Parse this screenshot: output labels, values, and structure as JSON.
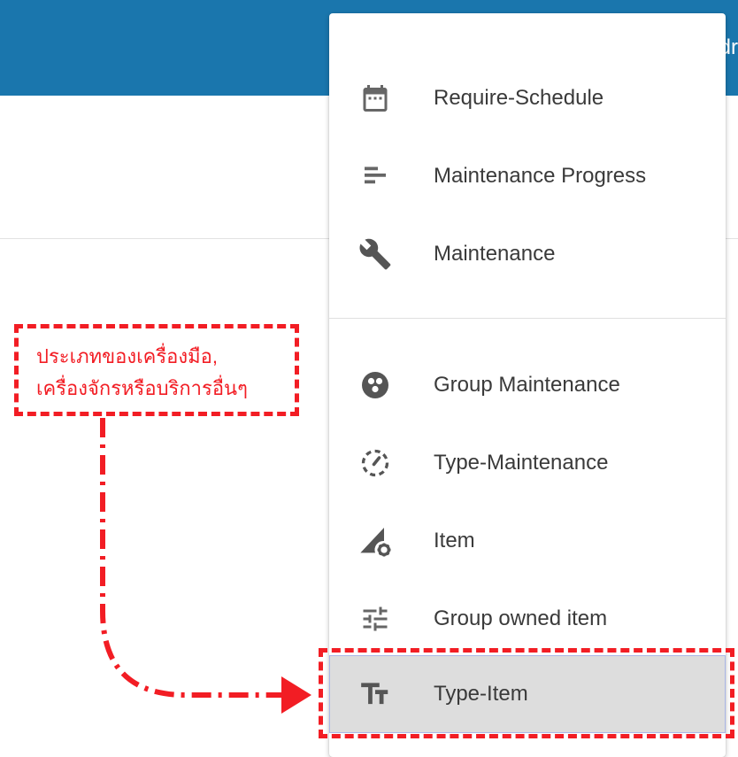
{
  "appbar": {
    "title_fragment": "dr",
    "color": "#1a76ad"
  },
  "menu": {
    "group1": [
      {
        "label": "Require-Schedule",
        "icon": "calendar-icon"
      },
      {
        "label": "Maintenance Progress",
        "icon": "bar-list-icon"
      },
      {
        "label": "Maintenance",
        "icon": "wrench-icon"
      }
    ],
    "group2": [
      {
        "label": "Group Maintenance",
        "icon": "group-circle-icon"
      },
      {
        "label": "Type-Maintenance",
        "icon": "dashed-gauge-icon"
      },
      {
        "label": "Item",
        "icon": "triangle-gear-icon"
      },
      {
        "label": "Group owned item",
        "icon": "sliders-icon"
      },
      {
        "label": "Type-Item",
        "icon": "text-size-icon",
        "selected": true
      }
    ]
  },
  "annotation": {
    "text_line1": "ประเภทของเครื่องมือ,",
    "text_line2": "เครื่องจักรหรือบริการอื่นๆ",
    "color": "#f21d24"
  }
}
